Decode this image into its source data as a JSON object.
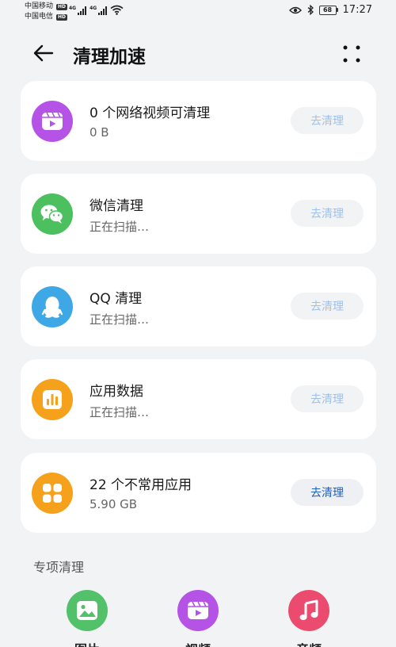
{
  "status_bar": {
    "carrier1": "中国移动",
    "carrier2": "中国电信",
    "hd_badge": "HD",
    "network1": "4G",
    "network2": "4G",
    "battery": "68",
    "time": "17:27"
  },
  "header": {
    "title": "清理加速"
  },
  "cards": [
    {
      "title": "0 个网络视频可清理",
      "subtitle": "0 B",
      "button": "去清理",
      "icon": "video-icon",
      "color": "#b453e6"
    },
    {
      "title": "微信清理",
      "subtitle": "正在扫描…",
      "button": "去清理",
      "icon": "wechat-icon",
      "color": "#4cbf5f"
    },
    {
      "title": "QQ 清理",
      "subtitle": "正在扫描…",
      "button": "去清理",
      "icon": "qq-penguin-icon",
      "color": "#3ea8e6"
    },
    {
      "title": "应用数据",
      "subtitle": "正在扫描…",
      "button": "去清理",
      "icon": "app-data-chart-icon",
      "color": "#f5a11b"
    },
    {
      "title": "22 个不常用应用",
      "subtitle": "5.90 GB",
      "button": "去清理",
      "icon": "app-grid-icon",
      "color": "#f5a11b"
    }
  ],
  "special": {
    "section_title": "专项清理",
    "items": [
      {
        "label": "图片",
        "icon": "image-icon",
        "color": "#52c16a"
      },
      {
        "label": "视频",
        "icon": "video-icon",
        "color": "#b453e6"
      },
      {
        "label": "音频",
        "icon": "music-icon",
        "color": "#ea4b6e"
      }
    ]
  }
}
